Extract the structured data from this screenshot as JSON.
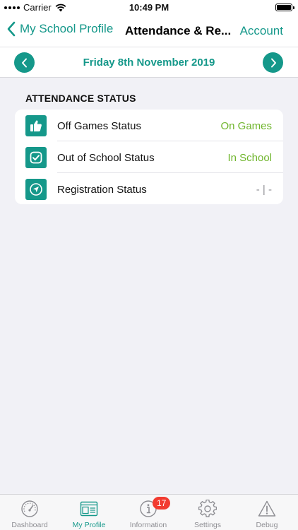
{
  "status_bar": {
    "carrier": "Carrier",
    "time": "10:49 PM",
    "battery_level": 1.0
  },
  "nav": {
    "back_label": "My School Profile",
    "title": "Attendance & Re...",
    "right_label": "Account"
  },
  "date_bar": {
    "date": "Friday 8th November 2019"
  },
  "attendance": {
    "heading": "ATTENDANCE STATUS",
    "rows": [
      {
        "label": "Off Games Status",
        "value": "On Games",
        "icon": "thumbs-up-icon"
      },
      {
        "label": "Out of School Status",
        "value": "In School",
        "icon": "checkmark-icon"
      },
      {
        "label": "Registration Status",
        "value": "- | -",
        "icon": "location-arrow-icon"
      }
    ]
  },
  "tabs": [
    {
      "label": "Dashboard",
      "icon": "speedometer-icon"
    },
    {
      "label": "My Profile",
      "icon": "profile-card-icon"
    },
    {
      "label": "Information",
      "icon": "info-icon",
      "badge": "17"
    },
    {
      "label": "Settings",
      "icon": "gear-icon"
    },
    {
      "label": "Debug",
      "icon": "warning-icon"
    }
  ],
  "colors": {
    "accent": "#15988a",
    "status_green": "#6fb52c",
    "badge_red": "#f23b30",
    "inactive_gray": "#8e8e93"
  }
}
